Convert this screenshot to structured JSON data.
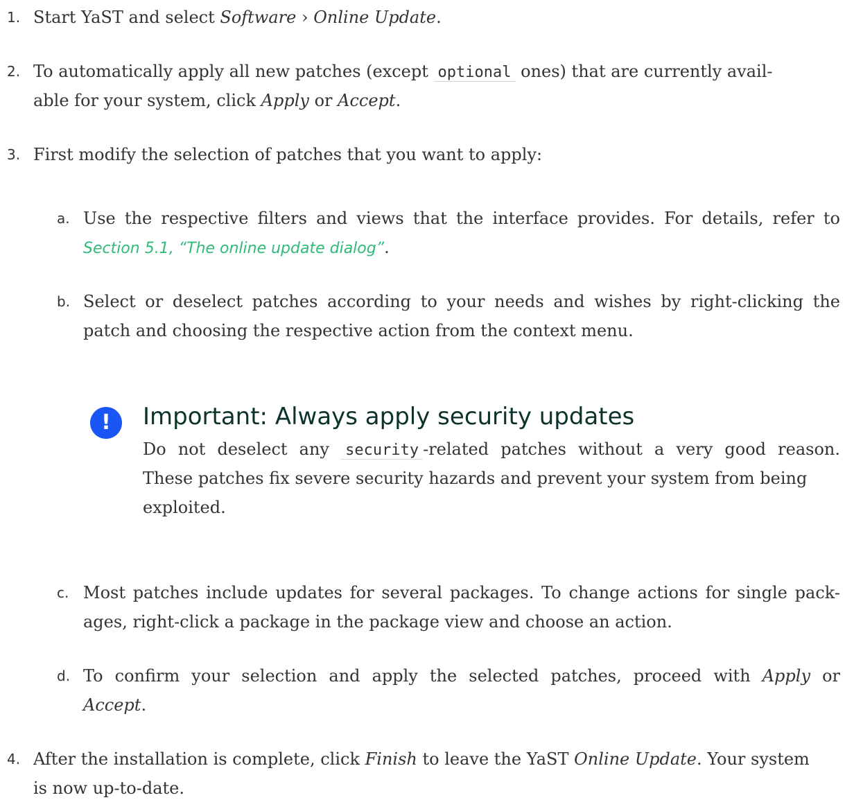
{
  "steps": [
    {
      "num": "1.",
      "lines": [
        {
          "a": "Start YaST and select ",
          "i1": "Software",
          "sep": " › ",
          "i2": "Online Update",
          "b": "."
        }
      ]
    },
    {
      "num": "2.",
      "line1": {
        "a": "To automatically apply all new patches (except ",
        "code": "optional",
        "b": " ones) that are currently avail-"
      },
      "line2": {
        "a": "able for your system, click ",
        "i1": "Apply",
        "mid": " or ",
        "i2": "Accept",
        "b": "."
      }
    },
    {
      "num": "3.",
      "line1": "First modify the selection of patches that you want to apply:"
    },
    {
      "num": "4.",
      "line1": {
        "a": "After the installation is complete, click ",
        "i1": "Finish",
        "mid": " to leave the YaST ",
        "i2": "Online Update",
        "b": ". Your system"
      },
      "line2": "is now up-to-date."
    }
  ],
  "substeps": {
    "a": {
      "num": "a.",
      "line1": "Use the respective filters and views that the interface provides. For details, refer to",
      "link": "Section 5.1, “The online update dialog”",
      "after_link": "."
    },
    "b": {
      "num": "b.",
      "line1": "Select or deselect patches according to your needs and wishes by right-clicking the",
      "line2": "patch and choosing the respective action from the context menu."
    },
    "c": {
      "num": "c.",
      "line1": "Most patches include updates for several packages. To change actions for single pack-",
      "line2": "ages, right-click a package in the package view and choose an action."
    },
    "d": {
      "num": "d.",
      "line1": {
        "a": "To confirm your selection and apply the selected patches, proceed with ",
        "i1": "Apply",
        "b": " or"
      },
      "line2": {
        "i1": "Accept",
        "b": "."
      }
    }
  },
  "admonition": {
    "icon": "!",
    "title": "Important: Always apply security updates",
    "line1": {
      "a": "Do not deselect any ",
      "code": "security",
      "b": "-related patches without a very good reason."
    },
    "line2": "These patches fix severe security hazards and prevent your system from being",
    "line3": "exploited."
  }
}
